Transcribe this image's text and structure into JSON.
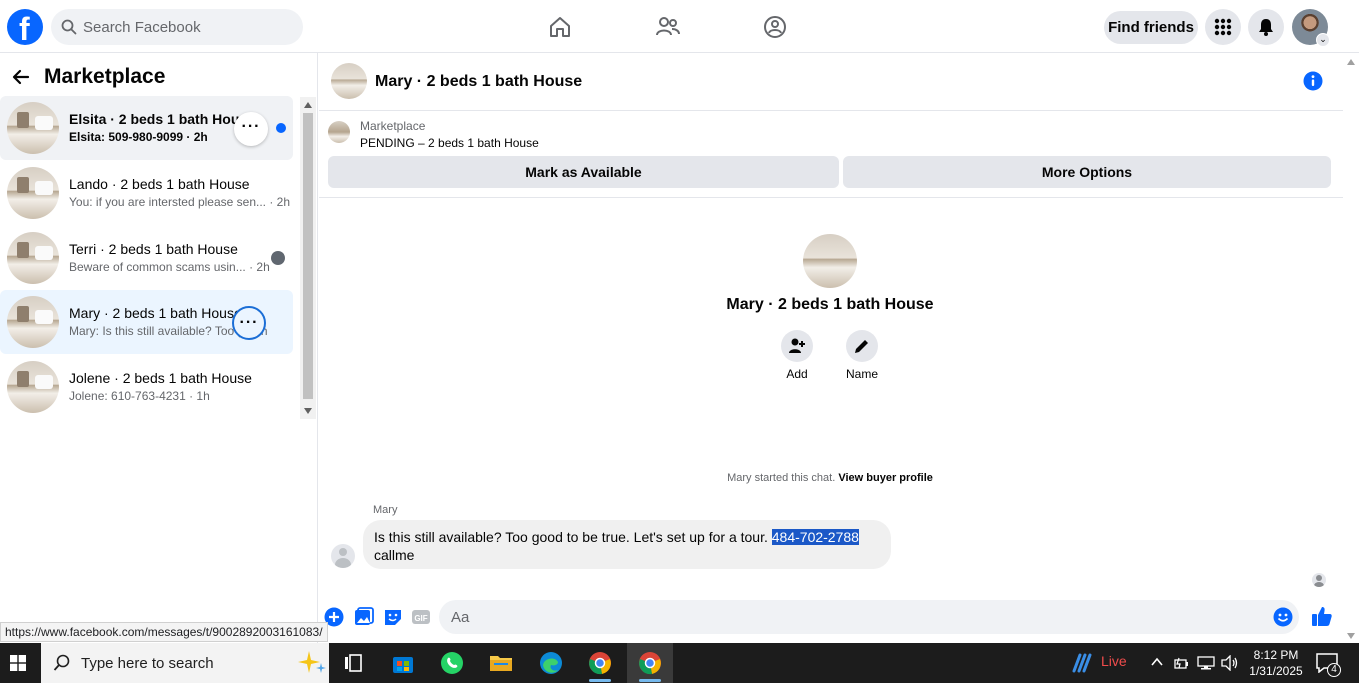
{
  "topbar": {
    "search_placeholder": "Search Facebook",
    "find_friends": "Find friends"
  },
  "sidebar": {
    "title": "Marketplace",
    "conversations": [
      {
        "title": "Elsita · 2 beds 1 bath House",
        "preview": "Elsita: 509-980-9099 · 2h"
      },
      {
        "title": "Lando · 2 beds 1 bath House",
        "preview": "You: if you are intersted please sen... · 2h"
      },
      {
        "title": "Terri · 2 beds 1 bath House",
        "preview": "Beware of common scams usin... · 2h"
      },
      {
        "title": "Mary · 2 beds 1 bath House",
        "preview": "Mary: Is this still available? Too go...h"
      },
      {
        "title": "Jolene · 2 beds 1 bath House",
        "preview": "Jolene: 610-763-4231 · 1h"
      }
    ]
  },
  "chat": {
    "title": "Mary · 2 beds 1 bath House",
    "marketplace_label": "Marketplace",
    "listing_status": "PENDING – 2 beds 1 bath House",
    "mark_available": "Mark as Available",
    "more_options": "More Options",
    "profile_title": "Mary · 2 beds 1 bath House",
    "add_label": "Add",
    "name_label": "Name",
    "started_text": "Mary started this chat.",
    "view_buyer": "View buyer profile",
    "sender": "Mary",
    "message_text": "Is this still available? Too good to be true. Let's set up for a tour. ",
    "message_phone": "484-702-2788",
    "message_line2": "callme",
    "composer_placeholder": "Aa"
  },
  "status_url": "https://www.facebook.com/messages/t/9002892003161083/",
  "taskbar": {
    "search_text": "Type here to search",
    "live": "Live",
    "time": "8:12 PM",
    "date": "1/31/2025",
    "notifications": "4"
  },
  "colors": {
    "facebook_blue": "#0866ff",
    "selection": "#1b58c7",
    "unread": "#0866ff"
  }
}
